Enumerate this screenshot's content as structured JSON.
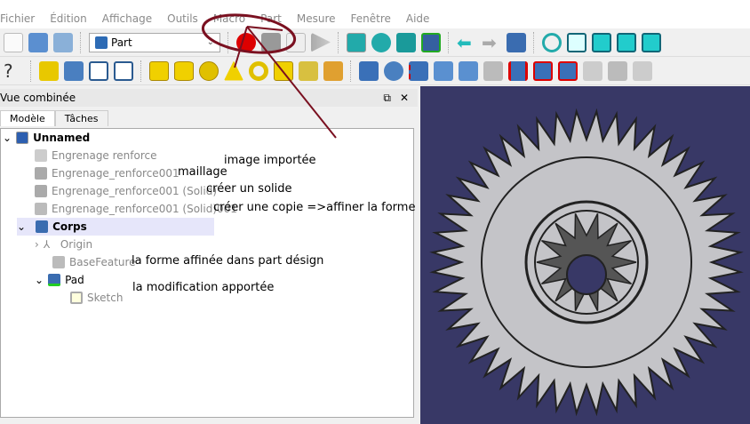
{
  "menu": [
    "Fichier",
    "Édition",
    "Affichage",
    "Outils",
    "Macro",
    "Part",
    "Mesure",
    "Fenêtre",
    "Aide"
  ],
  "toolbar": {
    "workbench": "Part"
  },
  "panel": {
    "title": "Vue combinée",
    "tabs": [
      "Modèle",
      "Tâches"
    ]
  },
  "tree": {
    "root": "Unnamed",
    "items": [
      "Engrenage renforce",
      "Engrenage_renforce001",
      "Engrenage_renforce001 (Solid)",
      "Engrenage_renforce001 (Solid)001"
    ],
    "body": "Corps",
    "origin": "Origin",
    "base": "BaseFeature",
    "pad": "Pad",
    "sketch": "Sketch"
  },
  "annotations": [
    "image importée",
    "maillage",
    "créer un solide",
    "créer une copie =>affiner la forme",
    "la forme affinée dans part désign",
    "la modification apportée"
  ],
  "colors": {
    "viewport": "#383866",
    "annotation": "#7a1020",
    "selection": "#e6e6fa"
  }
}
